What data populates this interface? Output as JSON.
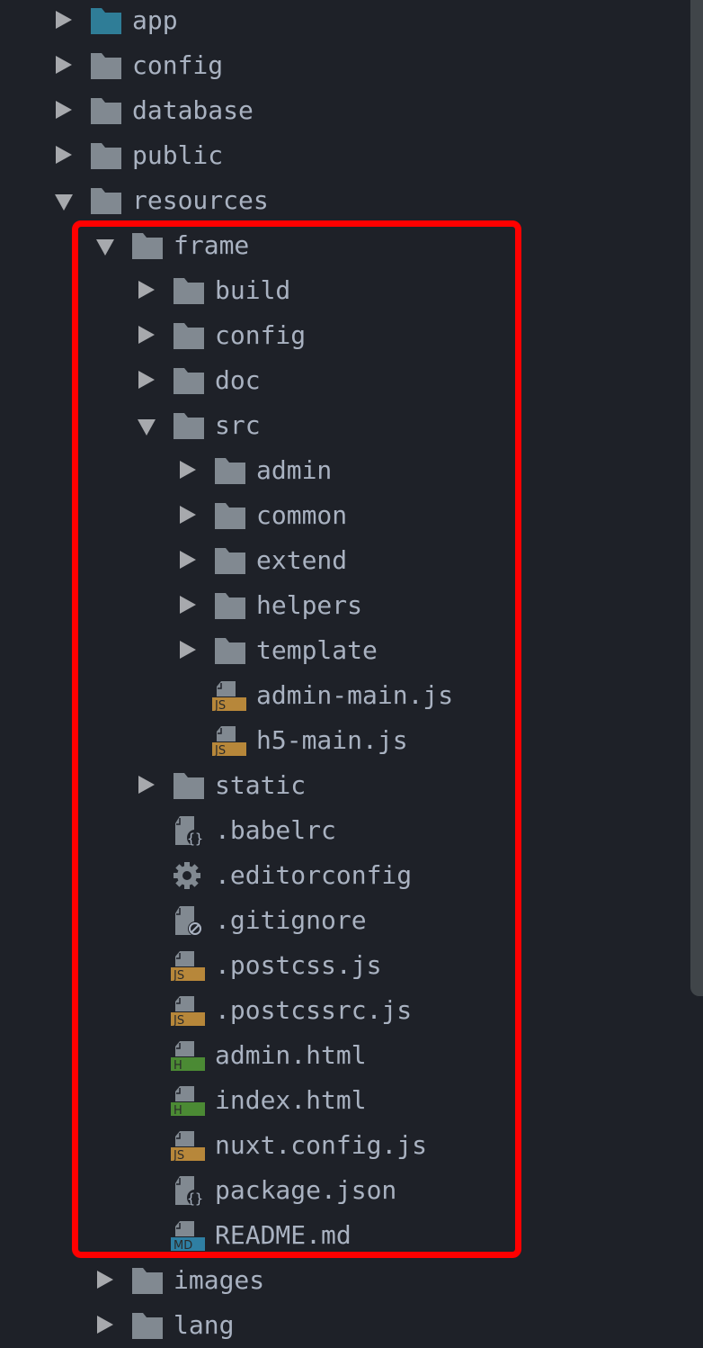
{
  "colors": {
    "background": "#1e2128",
    "text": "#a9b2c1",
    "folder": "#818991",
    "folder_app": "#2f7d97",
    "js_badge": "#b7873a",
    "html_badge": "#4b8a34",
    "md_badge": "#2f7fa3",
    "highlight_box": "#ff0000"
  },
  "tree": [
    {
      "label": "app",
      "type": "folder",
      "expanded": false,
      "level": 0,
      "icon": "folder-icon",
      "accent": true
    },
    {
      "label": "config",
      "type": "folder",
      "expanded": false,
      "level": 0,
      "icon": "folder-icon"
    },
    {
      "label": "database",
      "type": "folder",
      "expanded": false,
      "level": 0,
      "icon": "folder-icon"
    },
    {
      "label": "public",
      "type": "folder",
      "expanded": false,
      "level": 0,
      "icon": "folder-icon"
    },
    {
      "label": "resources",
      "type": "folder",
      "expanded": true,
      "level": 0,
      "icon": "folder-icon"
    },
    {
      "label": "frame",
      "type": "folder",
      "expanded": true,
      "level": 1,
      "icon": "folder-icon"
    },
    {
      "label": "build",
      "type": "folder",
      "expanded": false,
      "level": 2,
      "icon": "folder-icon"
    },
    {
      "label": "config",
      "type": "folder",
      "expanded": false,
      "level": 2,
      "icon": "folder-icon"
    },
    {
      "label": "doc",
      "type": "folder",
      "expanded": false,
      "level": 2,
      "icon": "folder-icon"
    },
    {
      "label": "src",
      "type": "folder",
      "expanded": true,
      "level": 2,
      "icon": "folder-icon"
    },
    {
      "label": "admin",
      "type": "folder",
      "expanded": false,
      "level": 3,
      "icon": "folder-icon"
    },
    {
      "label": "common",
      "type": "folder",
      "expanded": false,
      "level": 3,
      "icon": "folder-icon"
    },
    {
      "label": "extend",
      "type": "folder",
      "expanded": false,
      "level": 3,
      "icon": "folder-icon"
    },
    {
      "label": "helpers",
      "type": "folder",
      "expanded": false,
      "level": 3,
      "icon": "folder-icon"
    },
    {
      "label": "template",
      "type": "folder",
      "expanded": false,
      "level": 3,
      "icon": "folder-icon"
    },
    {
      "label": "admin-main.js",
      "type": "file",
      "level": 3,
      "icon": "js-file-icon",
      "badge": "JS"
    },
    {
      "label": "h5-main.js",
      "type": "file",
      "level": 3,
      "icon": "js-file-icon",
      "badge": "JS"
    },
    {
      "label": "static",
      "type": "folder",
      "expanded": false,
      "level": 2,
      "icon": "folder-icon"
    },
    {
      "label": ".babelrc",
      "type": "file",
      "level": 2,
      "icon": "json-file-icon"
    },
    {
      "label": ".editorconfig",
      "type": "file",
      "level": 2,
      "icon": "gear-icon"
    },
    {
      "label": ".gitignore",
      "type": "file",
      "level": 2,
      "icon": "ignore-file-icon"
    },
    {
      "label": ".postcss.js",
      "type": "file",
      "level": 2,
      "icon": "js-file-icon",
      "badge": "JS"
    },
    {
      "label": ".postcssrc.js",
      "type": "file",
      "level": 2,
      "icon": "js-file-icon",
      "badge": "JS"
    },
    {
      "label": "admin.html",
      "type": "file",
      "level": 2,
      "icon": "html-file-icon",
      "badge": "H"
    },
    {
      "label": "index.html",
      "type": "file",
      "level": 2,
      "icon": "html-file-icon",
      "badge": "H"
    },
    {
      "label": "nuxt.config.js",
      "type": "file",
      "level": 2,
      "icon": "js-file-icon",
      "badge": "JS"
    },
    {
      "label": "package.json",
      "type": "file",
      "level": 2,
      "icon": "json-file-icon"
    },
    {
      "label": "README.md",
      "type": "file",
      "level": 2,
      "icon": "markdown-file-icon",
      "badge": "MD"
    },
    {
      "label": "images",
      "type": "folder",
      "expanded": false,
      "level": 1,
      "icon": "folder-icon"
    },
    {
      "label": "lang",
      "type": "folder",
      "expanded": false,
      "level": 1,
      "icon": "folder-icon"
    }
  ]
}
